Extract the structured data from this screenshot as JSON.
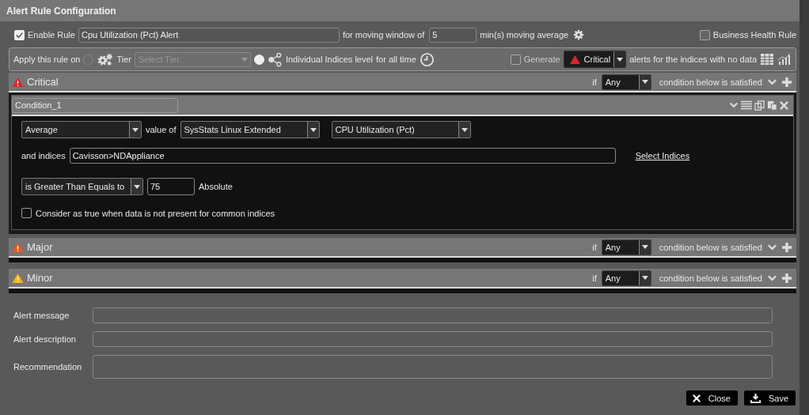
{
  "window": {
    "title": "Alert Rule Configuration"
  },
  "rule": {
    "enable_label": "Enable Rule",
    "enabled": true,
    "name": "Cpu Utilization (Pct) Alert",
    "window_label": "for moving window of",
    "window_value": "5",
    "window_unit": "min(s) moving average",
    "business_label": "Business Health Rule",
    "business": false
  },
  "apply": {
    "label": "Apply this rule on",
    "options": [
      {
        "label": "Tier",
        "selected": false,
        "kind": "tier",
        "placeholder": "Select Tier"
      },
      {
        "label": "Individual Indices level",
        "selected": true,
        "kind": "indices"
      }
    ],
    "time_label": "for all time",
    "generate_label": "Generate",
    "generate": false,
    "generate_severity": "Critical",
    "no_data_label": "alerts for the indices with no data"
  },
  "severities": [
    {
      "kind": "critical",
      "label": "Critical",
      "if_label": "if",
      "match": "Any",
      "condition_label": "condition below is satisfied",
      "expanded": true,
      "conditions": [
        {
          "name": "Condition_1",
          "aggregate": "Average",
          "value_of_label": "value of",
          "group": "SysStats Linux Extended",
          "metric": "CPU Utilization (Pct)",
          "indices_label": "and indices",
          "indices": "Cavisson>NDAppliance",
          "select_link": "Select Indices",
          "operator": "is Greater Than Equals to",
          "threshold": "75",
          "threshold_type": "Absolute",
          "consider_label": "Consider as true when data is not present for common indices",
          "consider": false
        }
      ]
    },
    {
      "kind": "major",
      "label": "Major",
      "if_label": "if",
      "match": "Any",
      "condition_label": "condition below is satisfied",
      "expanded": false
    },
    {
      "kind": "minor",
      "label": "Minor",
      "if_label": "if",
      "match": "Any",
      "condition_label": "condition below is satisfied",
      "expanded": false
    }
  ],
  "fields": [
    {
      "label": "Alert message",
      "kind": "line"
    },
    {
      "label": "Alert description",
      "kind": "line"
    },
    {
      "label": "Recommendation",
      "kind": "area"
    }
  ],
  "buttons": [
    {
      "label": "Close",
      "kind": "close"
    },
    {
      "label": "Save",
      "kind": "save"
    }
  ]
}
